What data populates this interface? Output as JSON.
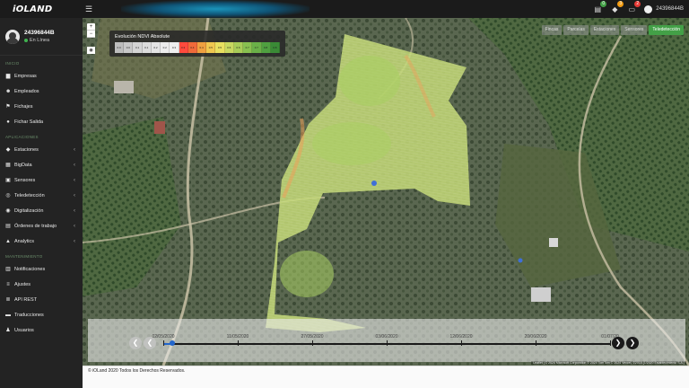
{
  "app": {
    "brand": "iOLAND"
  },
  "topbar": {
    "user": "24396844B",
    "badges": [
      {
        "icon": "cart-icon",
        "count": "0",
        "color": "#43a047"
      },
      {
        "icon": "bell-icon",
        "count": "3",
        "color": "#f39c12"
      },
      {
        "icon": "mail-icon",
        "count": "2",
        "color": "#e53935"
      }
    ]
  },
  "profile": {
    "name": "24396844B",
    "status": "En Línea"
  },
  "sidebar": {
    "sections": [
      {
        "title": "INICIO",
        "items": [
          {
            "label": "Empresas",
            "icon": "building-icon",
            "glyph": "▆",
            "chevron": false
          },
          {
            "label": "Empleados",
            "icon": "users-icon",
            "glyph": "☻",
            "chevron": false
          },
          {
            "label": "Fichajes",
            "icon": "clock-icon",
            "glyph": "⚑",
            "chevron": false
          },
          {
            "label": "Fichar Salida",
            "icon": "exit-icon",
            "glyph": "●",
            "chevron": false
          }
        ]
      },
      {
        "title": "APLICACIONES",
        "items": [
          {
            "label": "Estaciones",
            "icon": "location-pin-icon",
            "glyph": "◆",
            "chevron": true
          },
          {
            "label": "BigData",
            "icon": "database-icon",
            "glyph": "▦",
            "chevron": true
          },
          {
            "label": "Sensores",
            "icon": "sensor-icon",
            "glyph": "▣",
            "chevron": true
          },
          {
            "label": "Teledetección",
            "icon": "satellite-icon",
            "glyph": "◎",
            "chevron": true
          },
          {
            "label": "Digitalización",
            "icon": "digitize-icon",
            "glyph": "◉",
            "chevron": true
          },
          {
            "label": "Órdenes de trabajo",
            "icon": "clipboard-icon",
            "glyph": "▤",
            "chevron": true
          },
          {
            "label": "Analytics",
            "icon": "analytics-icon",
            "glyph": "▲",
            "chevron": true
          }
        ]
      },
      {
        "title": "MANTENIMIENTO",
        "items": [
          {
            "label": "Notificaciones",
            "icon": "notification-icon",
            "glyph": "▥",
            "chevron": false
          },
          {
            "label": "Ajustes",
            "icon": "settings-icon",
            "glyph": "≡",
            "chevron": false
          },
          {
            "label": "API REST",
            "icon": "api-icon",
            "glyph": "≣",
            "chevron": false
          },
          {
            "label": "Traducciones",
            "icon": "translate-icon",
            "glyph": "▬",
            "chevron": false
          },
          {
            "label": "Usuarios",
            "icon": "user-icon",
            "glyph": "♟",
            "chevron": false
          }
        ]
      }
    ]
  },
  "map": {
    "legend_title": "Evolución NDVI Absolute",
    "legend_scale": [
      {
        "label": "0.0",
        "color": "#bdbdbd"
      },
      {
        "label": "0.0",
        "color": "#c8c8c8"
      },
      {
        "label": "0.1",
        "color": "#d4d4d4"
      },
      {
        "label": "0.1",
        "color": "#dcdcdc"
      },
      {
        "label": "0.2",
        "color": "#e4e4e4"
      },
      {
        "label": "0.2",
        "color": "#ececec"
      },
      {
        "label": "0.3",
        "color": "#f0f0f0"
      },
      {
        "label": "0.3",
        "color": "#ff4a3d"
      },
      {
        "label": "0.4",
        "color": "#f06a3a"
      },
      {
        "label": "0.4",
        "color": "#f0a040"
      },
      {
        "label": "0.5",
        "color": "#f0c850"
      },
      {
        "label": "0.5",
        "color": "#e8e060"
      },
      {
        "label": "0.6",
        "color": "#c8d860"
      },
      {
        "label": "0.6",
        "color": "#a8cc58"
      },
      {
        "label": "0.7",
        "color": "#88c050"
      },
      {
        "label": "0.7",
        "color": "#6ab048"
      },
      {
        "label": "0.8",
        "color": "#4fa040"
      },
      {
        "label": "0.8",
        "color": "#3a8a36"
      }
    ],
    "tabs": [
      {
        "label": "Fincas",
        "active": false
      },
      {
        "label": "Parcelas",
        "active": false
      },
      {
        "label": "Estaciones",
        "active": false
      },
      {
        "label": "Sensores",
        "active": false
      },
      {
        "label": "Teledetección",
        "active": true
      }
    ],
    "timeline": {
      "dates": [
        "02/05/2020",
        "11/05/2020",
        "27/05/2020",
        "03/06/2020",
        "12/06/2020",
        "20/06/2020",
        "01/07/20"
      ],
      "progress": 0.02
    },
    "attribution": "Leaflet | © 2024 Microsoft Corporation © 2024 TomTom © 2024 Vexcel, ©2015 (1/2020 Establecimiento S.A.)"
  },
  "footer": {
    "text": "© iOLand 2020 Todos los Derechos Reservados."
  }
}
